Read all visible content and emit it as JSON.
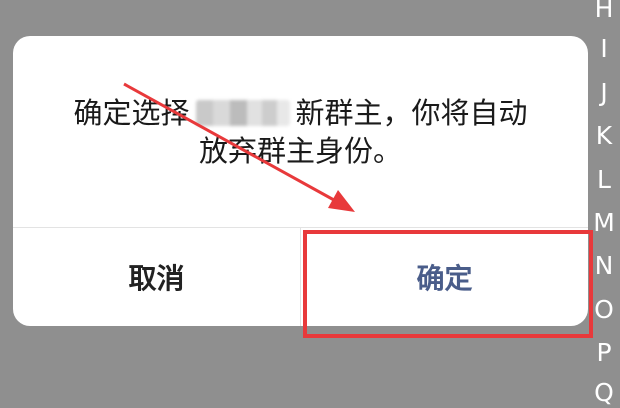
{
  "dialog": {
    "message_part1": "确定选择",
    "message_part2": "新群主，你将自动",
    "message_line2": "放弃群主身份。",
    "cancel_label": "取消",
    "confirm_label": "确定"
  },
  "index_bar": {
    "letters": [
      "H",
      "I",
      "J",
      "K",
      "L",
      "M",
      "N",
      "O",
      "P",
      "Q"
    ]
  },
  "colors": {
    "overlay": "#8f8f8f",
    "confirm_text": "#4a5d8a",
    "annotation_red": "#e8393b"
  }
}
